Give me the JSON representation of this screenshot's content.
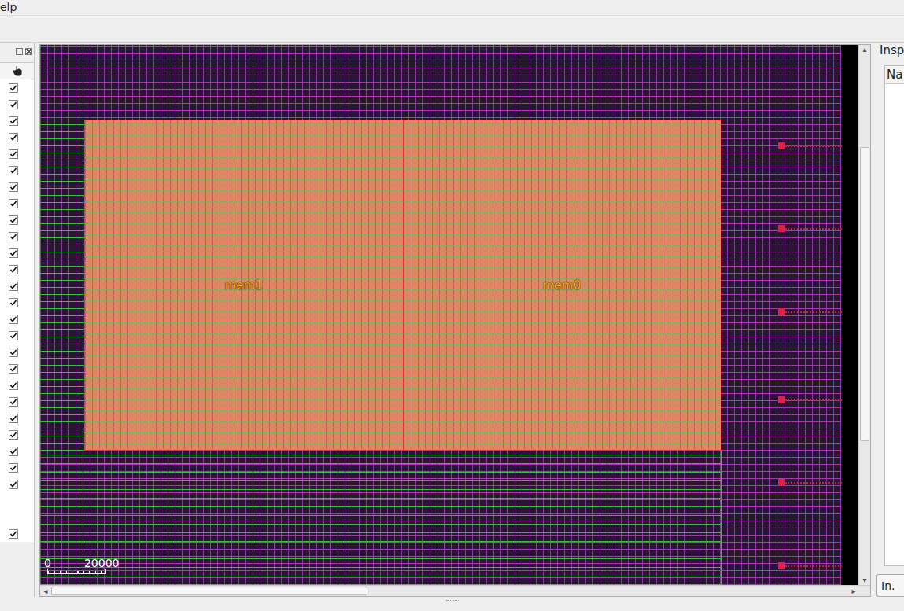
{
  "menu": [
    "elp"
  ],
  "layers_panel": {
    "rows": [
      {
        "kind": "layer",
        "checked": true
      },
      {
        "kind": "layer",
        "checked": true
      },
      {
        "kind": "layer",
        "checked": true
      },
      {
        "kind": "layer",
        "checked": true
      },
      {
        "kind": "layer",
        "checked": true
      },
      {
        "kind": "layer",
        "checked": true
      },
      {
        "kind": "layer",
        "checked": true
      },
      {
        "kind": "layer",
        "checked": true
      },
      {
        "kind": "layer",
        "checked": true
      },
      {
        "kind": "layer",
        "checked": true
      },
      {
        "kind": "layer",
        "checked": true
      },
      {
        "kind": "layer",
        "checked": true
      },
      {
        "kind": "layer",
        "checked": true
      },
      {
        "kind": "layer",
        "checked": true
      },
      {
        "kind": "layer",
        "checked": true
      },
      {
        "kind": "layer",
        "checked": true
      },
      {
        "kind": "layer",
        "checked": true
      },
      {
        "kind": "layer",
        "checked": true
      },
      {
        "kind": "layer",
        "checked": true
      },
      {
        "kind": "layer",
        "checked": true
      },
      {
        "kind": "layer",
        "checked": true
      },
      {
        "kind": "layer",
        "checked": true
      },
      {
        "kind": "layer",
        "checked": true
      },
      {
        "kind": "layer",
        "checked": true
      },
      {
        "kind": "layer",
        "checked": true
      },
      {
        "kind": "blank"
      },
      {
        "kind": "blank"
      },
      {
        "kind": "layer",
        "checked": true
      }
    ]
  },
  "layout": {
    "macros": [
      {
        "name": "mem1"
      },
      {
        "name": "mem0"
      }
    ],
    "scale": {
      "start": "0",
      "end": "20000"
    }
  },
  "inspector": {
    "title": "Insp",
    "column": "Na",
    "button": "In."
  }
}
